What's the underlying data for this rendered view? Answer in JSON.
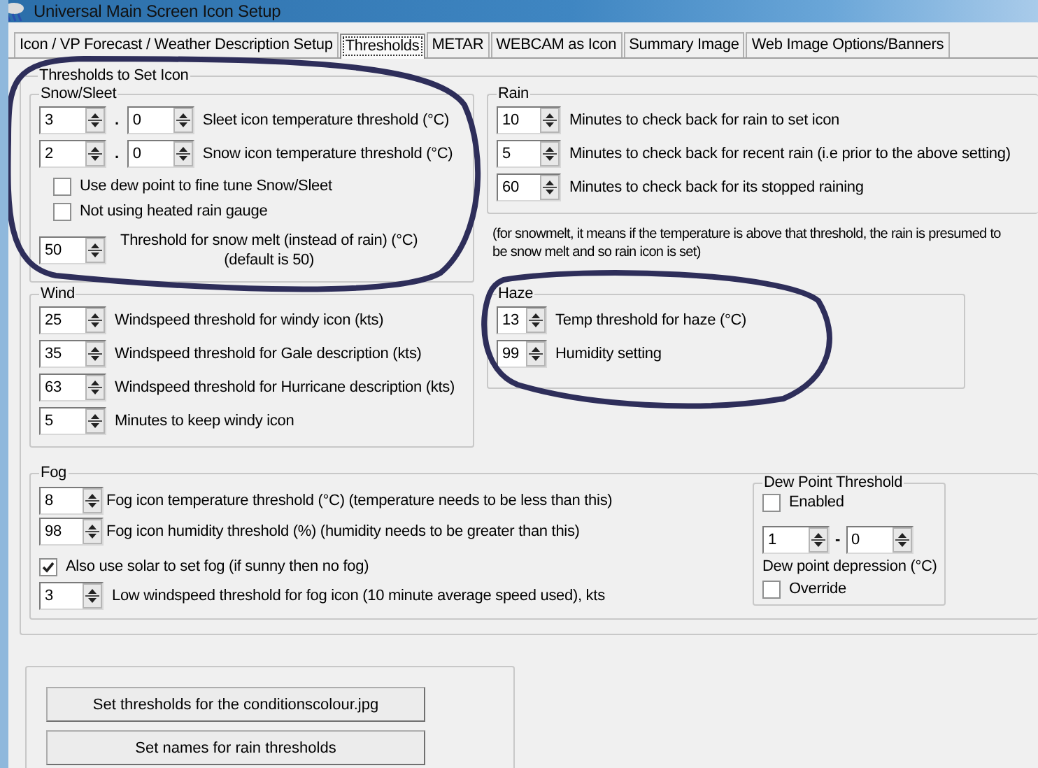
{
  "window": {
    "title": "Universal Main Screen Icon Setup"
  },
  "tabs": [
    {
      "label": "Icon / VP Forecast / Weather Description Setup",
      "selected": false
    },
    {
      "label": "Thresholds",
      "selected": true
    },
    {
      "label": "METAR",
      "selected": false
    },
    {
      "label": "WEBCAM as Icon",
      "selected": false
    },
    {
      "label": "Summary Image",
      "selected": false
    },
    {
      "label": "Web Image Options/Banners",
      "selected": false
    }
  ],
  "thresholds": {
    "title": "Thresholds to Set Icon",
    "snow_sleet": {
      "title": "Snow/Sleet",
      "rows": [
        {
          "value": "3",
          "separator": ".",
          "decimal": "0",
          "label": "Sleet icon temperature threshold (°C)"
        },
        {
          "value": "2",
          "separator": ".",
          "decimal": "0",
          "label": "Snow icon temperature threshold (°C)"
        }
      ],
      "checkboxes": [
        {
          "label": "Use dew point to fine tune Snow/Sleet",
          "checked": false
        },
        {
          "label": "Not using heated rain gauge",
          "checked": false
        }
      ],
      "snow_melt": {
        "value": "50",
        "label": "Threshold for snow melt (instead of rain) (°C)",
        "note": "(default is 50)"
      }
    },
    "rain": {
      "title": "Rain",
      "rows": [
        {
          "value": "10",
          "label": "Minutes to check back for rain to set icon"
        },
        {
          "value": "5",
          "label": "Minutes to check back for recent rain  (i.e prior to the above setting)"
        },
        {
          "value": "60",
          "label": "Minutes to check back for its stopped raining"
        }
      ]
    },
    "snowmelt_note": "(for snowmelt, it means if the temperature is above that threshold, the rain is presumed to be snow melt and so rain icon is set)",
    "wind": {
      "title": "Wind",
      "rows": [
        {
          "value": "25",
          "label": "Windspeed threshold for windy icon (kts)"
        },
        {
          "value": "35",
          "label": "Windspeed threshold for Gale description (kts)"
        },
        {
          "value": "63",
          "label": "Windspeed threshold for Hurricane description (kts)"
        },
        {
          "value": "5",
          "label": "Minutes to keep windy icon"
        }
      ]
    },
    "haze": {
      "title": "Haze",
      "rows": [
        {
          "value": "13",
          "label": "Temp threshold for haze (°C)"
        },
        {
          "value": "99",
          "label": "Humidity setting"
        }
      ]
    },
    "fog": {
      "title": "Fog",
      "rows": [
        {
          "value": "8",
          "label": "Fog icon temperature threshold (°C) (temperature needs to be less than this)"
        },
        {
          "value": "98",
          "label": "Fog icon humidity threshold (%) (humidity needs to be greater than this)"
        }
      ],
      "solar": {
        "label": "Also use solar to set fog (if sunny then no fog)",
        "checked": true
      },
      "low_wind": {
        "value": "3",
        "label": "Low windspeed threshold for fog icon (10 minute average speed used), kts"
      },
      "dew_point": {
        "title": "Dew Point Threshold",
        "enabled": {
          "label": "Enabled",
          "checked": false
        },
        "value": "1",
        "separator": "-",
        "decimal": "0",
        "label": "Dew point depression (°C)",
        "override": {
          "label": "Override",
          "checked": false
        }
      }
    }
  },
  "buttons": [
    "Set thresholds for the conditionscolour.jpg",
    "Set names for rain thresholds"
  ]
}
